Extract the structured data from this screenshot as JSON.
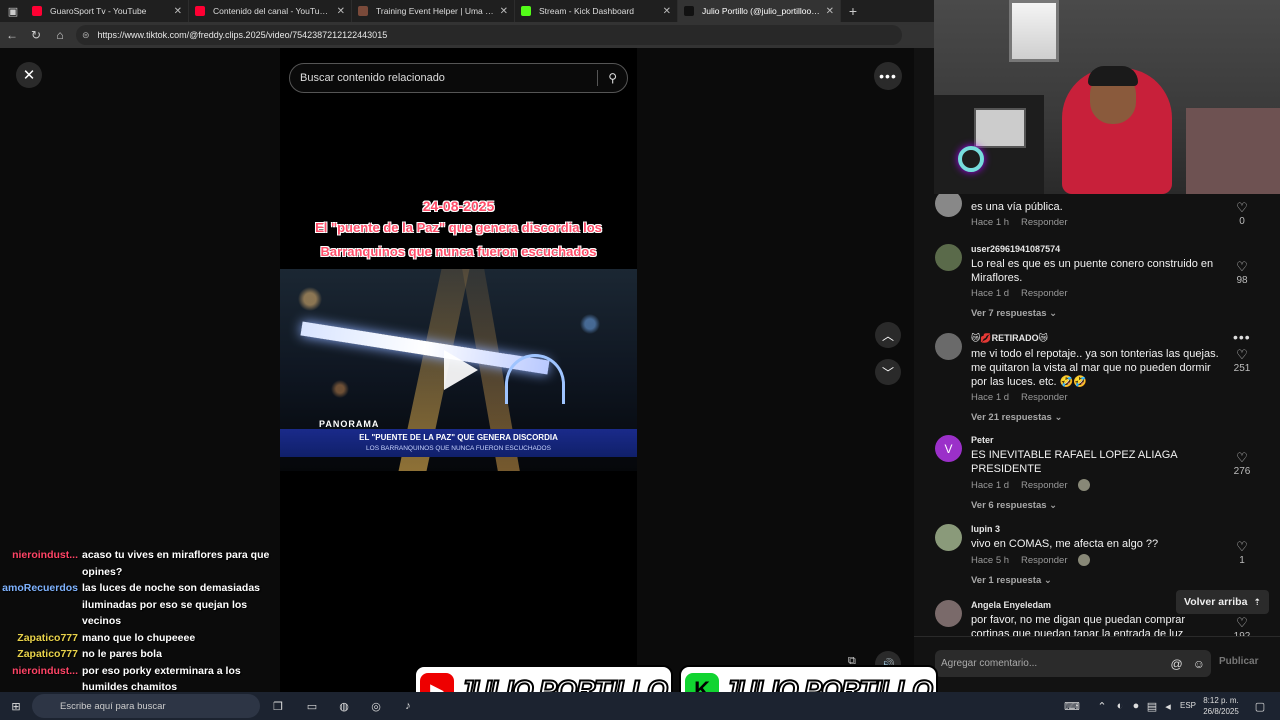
{
  "browser": {
    "tabs": [
      {
        "label": "GuaroSport Tv - YouTube",
        "color": "#ff0033",
        "active": false
      },
      {
        "label": "Contenido del canal - YouTube St",
        "color": "#ff0033",
        "active": false
      },
      {
        "label": "Training Event Helper | Uma Musu",
        "color": "#7a4a3a",
        "active": false
      },
      {
        "label": "Stream - Kick Dashboard",
        "color": "#53fc18",
        "active": false
      },
      {
        "label": "Julio Portillo (@julio_portilloo) | T",
        "color": "#111111",
        "active": true
      }
    ],
    "url": "https://www.tiktok.com/@freddy.clips.2025/video/7542387212122443015"
  },
  "player": {
    "search_placeholder": "Buscar contenido relacionado",
    "video": {
      "date": "24-08-2025",
      "title_line1": "El \"puente de la Paz\" que genera discordia los",
      "title_line2": "Barranquinos que nunca fueron escuchados",
      "channel_tag": "PANORAMA",
      "lower_third_title": "EL \"PUENTE DE LA PAZ\" QUE GENERA DISCORDIA",
      "lower_third_subtitle": "LOS BARRANQUINOS QUE NUNCA FUERON ESCUCHADOS"
    }
  },
  "chat": [
    {
      "user": "nieroindust...",
      "color": "#ff4466",
      "message": "acaso tu vives en miraflores para que opines?"
    },
    {
      "user": "amoRecuerdos",
      "color": "#7fb3ff",
      "message": "las luces de noche son demasiadas iluminadas por eso se quejan los vecinos"
    },
    {
      "user": "Zapatico777",
      "color": "#e8d24a",
      "message": "mano que lo chupeeee"
    },
    {
      "user": "Zapatico777",
      "color": "#e8d24a",
      "message": "no le pares bola"
    },
    {
      "user": "nieroindust...",
      "color": "#ff4466",
      "message": "por eso porky exterminara a los humildes chamitos"
    }
  ],
  "comments": [
    {
      "user": "",
      "text": "es una vía pública.",
      "time": "Hace 1 h",
      "reply": "Responder",
      "likes": "0",
      "replies": "",
      "avatar": "",
      "avatar_color": "#888888",
      "creator_liked": false
    },
    {
      "user": "user26961941087574",
      "text": "Lo real es que es un puente conero construido en Miraflores.",
      "time": "Hace 1 d",
      "reply": "Responder",
      "likes": "98",
      "replies": "Ver 7 respuestas",
      "avatar": "",
      "avatar_color": "#5a6a4a",
      "creator_liked": false
    },
    {
      "user": "😿💋RETIRADO😿",
      "text": "me vi todo el repotaje.. ya son tonterias las quejas. me quitaron la vista al mar que no pueden dormir por las luces. etc. 🤣🤣",
      "time": "Hace 1 d",
      "reply": "Responder",
      "likes": "251",
      "replies": "Ver 21 respuestas",
      "avatar": "",
      "avatar_color": "#6a6a6a",
      "creator_liked": false
    },
    {
      "user": "Peter",
      "text": "ES INEVITABLE RAFAEL LOPEZ ALIAGA PRESIDENTE",
      "time": "Hace 1 d",
      "reply": "Responder",
      "likes": "276",
      "replies": "Ver 6 respuestas",
      "avatar": "V",
      "avatar_color": "#9b30c9",
      "creator_liked": true
    },
    {
      "user": "lupin 3",
      "text": "vivo en COMAS, me afecta en algo ??",
      "time": "Hace 5 h",
      "reply": "Responder",
      "likes": "1",
      "replies": "Ver 1 respuesta",
      "avatar": "",
      "avatar_color": "#8a9a7a",
      "creator_liked": true
    },
    {
      "user": "Angela Enyeledam",
      "text": "por favor, no me digan que puedan comprar cortinas que puedan tapar la entrada de luz",
      "time": "",
      "reply": "",
      "likes": "192",
      "replies": "",
      "avatar": "",
      "avatar_color": "#7a6a6a",
      "creator_liked": false
    }
  ],
  "panel": {
    "back_to_top": "Volver arriba",
    "comment_placeholder": "Agregar comentario...",
    "publish": "Publicar"
  },
  "overlay": {
    "name_youtube": "JULIO PORTILLO",
    "name_kick": "JULIO PORTILLO"
  },
  "taskbar": {
    "search_placeholder": "Escribe aquí para buscar",
    "language": "ESP",
    "time": "8:12 p. m.",
    "date": "26/8/2025"
  },
  "icons": {
    "close": "close-icon",
    "search": "search-icon",
    "more": "more-options-icon",
    "heart": "heart-icon"
  }
}
